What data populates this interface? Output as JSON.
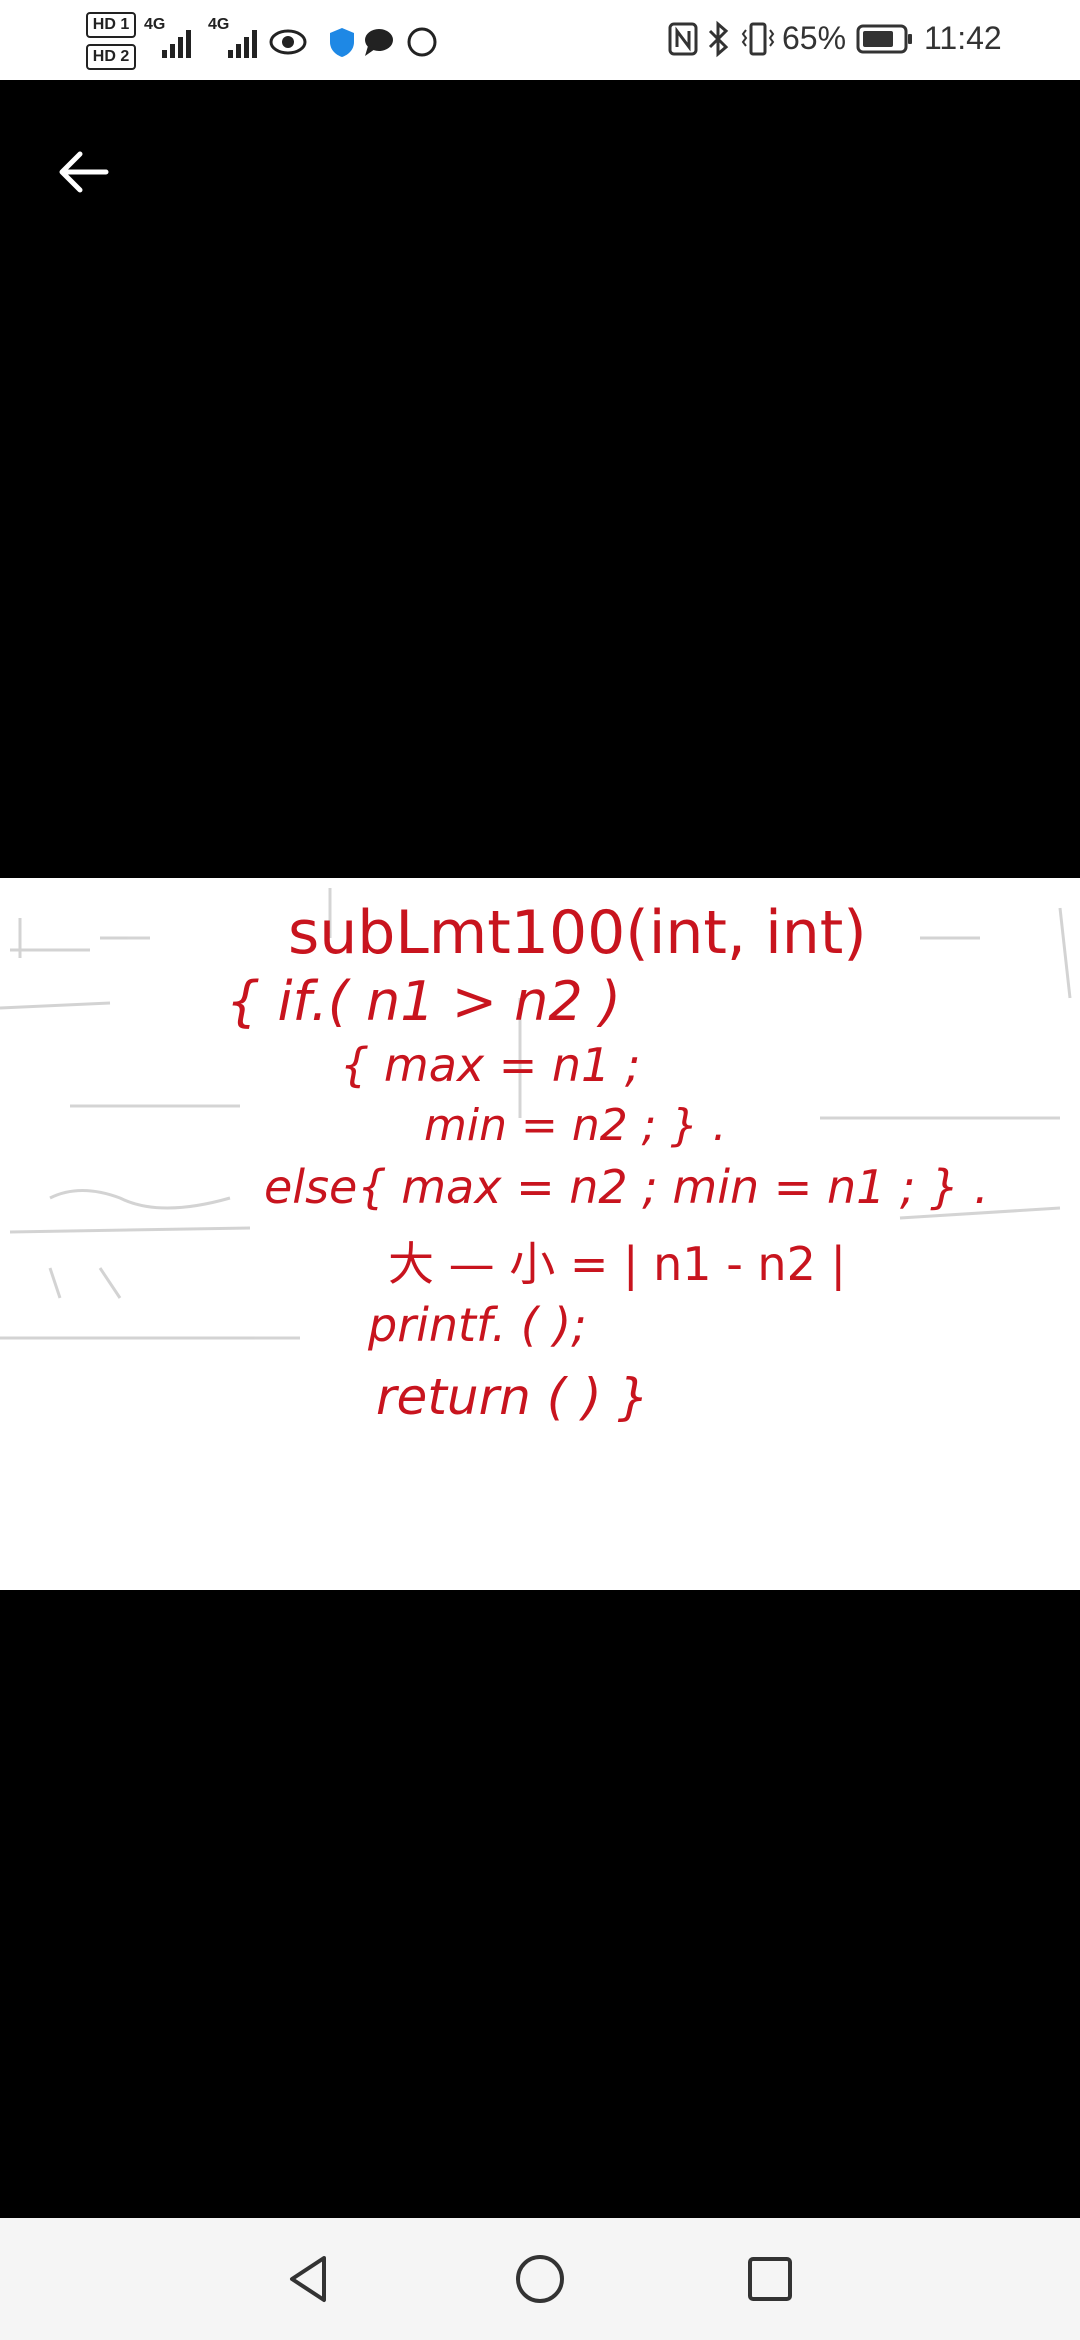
{
  "status_bar": {
    "sim1_label": "HD 1",
    "sim2_label": "HD 2",
    "network1": "4G",
    "network2": "4G",
    "battery_percent": "65%",
    "time": "11:42",
    "icons": [
      "eye-icon",
      "shield-icon",
      "chat-bubble-icon",
      "ring-icon",
      "nfc-icon",
      "bluetooth-icon",
      "vibrate-icon",
      "battery-icon"
    ]
  },
  "viewer": {
    "back_icon": "arrow-left-icon"
  },
  "handwriting": {
    "line1": "subLmt100(int, int)",
    "line2": "{ if.(  n1 > n2 )",
    "line3": "{  max = n1 ;",
    "line4": "min = n2 ; } .",
    "line5": "else{  max = n2 ; min = n1 ; } .",
    "line6": "大 — 小 = | n1 - n2 |",
    "line7": "printf. (                 );",
    "line8": "return (          )            }"
  },
  "colors": {
    "ink": "#c8141e",
    "paper": "#ffffff",
    "background": "#000000"
  },
  "nav_bar": {
    "icons": [
      "back-triangle-icon",
      "home-circle-icon",
      "recent-square-icon"
    ]
  }
}
